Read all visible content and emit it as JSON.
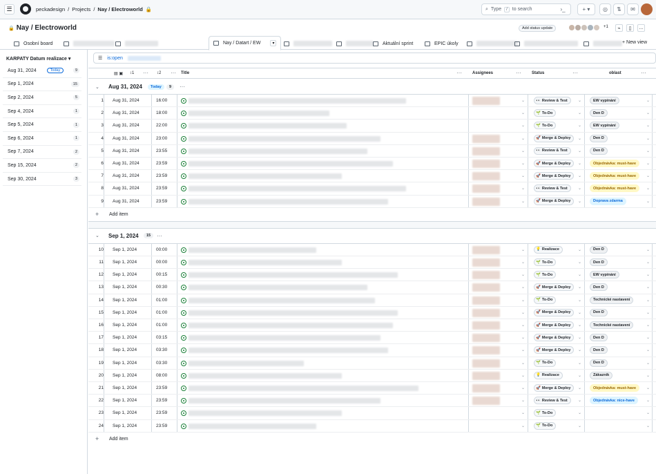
{
  "topbar": {
    "owner": "peckadesign",
    "projects": "Projects",
    "project": "Nay / Electroworld",
    "search_label": "Type",
    "search_key": "/",
    "search_suffix": "to search"
  },
  "title": {
    "name": "Nay / Electroworld",
    "status_update": "Add status update",
    "more_collaborators": "+1"
  },
  "tabs": [
    {
      "label": "Osobní board"
    },
    {
      "label": ""
    },
    {
      "label": ""
    },
    {
      "label": "Nay / Datart / EW"
    },
    {
      "label": ""
    },
    {
      "label": ""
    },
    {
      "label": "Aktuální sprint"
    },
    {
      "label": "EPIC úkoly"
    },
    {
      "label": ""
    },
    {
      "label": ""
    },
    {
      "label": ""
    }
  ],
  "new_view": "New view",
  "sidebar": {
    "header": "KARPATY Datum realizace",
    "items": [
      {
        "label": "Aug 31, 2024",
        "today": "Today",
        "count": "9"
      },
      {
        "label": "Sep 1, 2024",
        "count": "15"
      },
      {
        "label": "Sep 2, 2024",
        "count": "5"
      },
      {
        "label": "Sep 4, 2024",
        "count": "1"
      },
      {
        "label": "Sep 5, 2024",
        "count": "1"
      },
      {
        "label": "Sep 6, 2024",
        "count": "1"
      },
      {
        "label": "Sep 7, 2024",
        "count": "2"
      },
      {
        "label": "Sep 15, 2024",
        "count": "2"
      },
      {
        "label": "Sep 30, 2024",
        "count": "3"
      }
    ]
  },
  "filter": {
    "text": "is:open"
  },
  "columns": {
    "title": "Title",
    "assignees": "Assignees",
    "status": "Status",
    "area": "oblast",
    "sort1": "1",
    "sort2": "2"
  },
  "groups": [
    {
      "label": "Aug 31, 2024",
      "today": "Today",
      "count": "9"
    },
    {
      "label": "Sep 1, 2024",
      "count": "15"
    }
  ],
  "add_item": "Add item",
  "rows": [
    {
      "n": "1",
      "date": "Aug 31, 2024",
      "time": "16:00",
      "status": "Review & Test",
      "emoji": "👀",
      "area": "EW vypínání",
      "tw": 0.85,
      "assigned": true
    },
    {
      "n": "2",
      "date": "Aug 31, 2024",
      "time": "18:00",
      "status": "To-Do",
      "emoji": "🌱",
      "area": "Den D",
      "tw": 0.55,
      "assigned": false
    },
    {
      "n": "3",
      "date": "Aug 31, 2024",
      "time": "22:00",
      "status": "To-Do",
      "emoji": "🌱",
      "area": "EW vypínání",
      "tw": 0.62,
      "assigned": false
    },
    {
      "n": "4",
      "date": "Aug 31, 2024",
      "time": "23:00",
      "status": "Merge & Deploy",
      "emoji": "🚀",
      "area": "Den D",
      "tw": 0.75,
      "assigned": true
    },
    {
      "n": "5",
      "date": "Aug 31, 2024",
      "time": "23:55",
      "status": "Review & Test",
      "emoji": "👀",
      "area": "Den D",
      "tw": 0.7,
      "assigned": true
    },
    {
      "n": "6",
      "date": "Aug 31, 2024",
      "time": "23:59",
      "status": "Merge & Deploy",
      "emoji": "🚀",
      "area": "Objednávka: must-have",
      "tw": 0.8,
      "assigned": true
    },
    {
      "n": "7",
      "date": "Aug 31, 2024",
      "time": "23:59",
      "status": "Merge & Deploy",
      "emoji": "🚀",
      "area": "Objednávka: must-have",
      "tw": 0.6,
      "assigned": true
    },
    {
      "n": "8",
      "date": "Aug 31, 2024",
      "time": "23:59",
      "status": "Review & Test",
      "emoji": "👀",
      "area": "Objednávka: must-have",
      "tw": 0.85,
      "assigned": true
    },
    {
      "n": "9",
      "date": "Aug 31, 2024",
      "time": "23:59",
      "status": "Merge & Deploy",
      "emoji": "🚀",
      "area": "Doprava zdarma",
      "tw": 0.78,
      "assigned": true
    },
    {
      "n": "10",
      "date": "Sep 1, 2024",
      "time": "00:00",
      "status": "Realizace",
      "emoji": "💡",
      "area": "Den D",
      "tw": 0.5,
      "assigned": true
    },
    {
      "n": "11",
      "date": "Sep 1, 2024",
      "time": "00:00",
      "status": "To-Do",
      "emoji": "🌱",
      "area": "Den D",
      "tw": 0.6,
      "assigned": true
    },
    {
      "n": "12",
      "date": "Sep 1, 2024",
      "time": "00:15",
      "status": "To-Do",
      "emoji": "🌱",
      "area": "EW vypínání",
      "tw": 0.82,
      "assigned": true
    },
    {
      "n": "13",
      "date": "Sep 1, 2024",
      "time": "00:30",
      "status": "Merge & Deploy",
      "emoji": "🚀",
      "area": "Den D",
      "tw": 0.7,
      "assigned": true
    },
    {
      "n": "14",
      "date": "Sep 1, 2024",
      "time": "01:00",
      "status": "To-Do",
      "emoji": "🌱",
      "area": "Technické nastavení",
      "tw": 0.73,
      "assigned": true
    },
    {
      "n": "15",
      "date": "Sep 1, 2024",
      "time": "01:00",
      "status": "Merge & Deploy",
      "emoji": "🚀",
      "area": "Den D",
      "tw": 0.82,
      "assigned": true
    },
    {
      "n": "16",
      "date": "Sep 1, 2024",
      "time": "01:00",
      "status": "Merge & Deploy",
      "emoji": "🚀",
      "area": "Technické nastavení",
      "tw": 0.8,
      "assigned": true
    },
    {
      "n": "17",
      "date": "Sep 1, 2024",
      "time": "03:15",
      "status": "Merge & Deploy",
      "emoji": "🚀",
      "area": "Den D",
      "tw": 0.75,
      "assigned": true
    },
    {
      "n": "18",
      "date": "Sep 1, 2024",
      "time": "03:30",
      "status": "Merge & Deploy",
      "emoji": "🚀",
      "area": "Den D",
      "tw": 0.78,
      "assigned": true
    },
    {
      "n": "19",
      "date": "Sep 1, 2024",
      "time": "03:30",
      "status": "To-Do",
      "emoji": "🌱",
      "area": "Den D",
      "tw": 0.45,
      "assigned": true
    },
    {
      "n": "20",
      "date": "Sep 1, 2024",
      "time": "08:00",
      "status": "Realizace",
      "emoji": "💡",
      "area": "Zákazník",
      "tw": 0.6,
      "assigned": true
    },
    {
      "n": "21",
      "date": "Sep 1, 2024",
      "time": "23:59",
      "status": "Merge & Deploy",
      "emoji": "🚀",
      "area": "Objednávka: must-have",
      "tw": 0.9,
      "assigned": true
    },
    {
      "n": "22",
      "date": "Sep 1, 2024",
      "time": "23:59",
      "status": "Review & Test",
      "emoji": "👀",
      "area": "Objednávka: nice-have",
      "tw": 0.75,
      "assigned": true
    },
    {
      "n": "23",
      "date": "Sep 1, 2024",
      "time": "23:59",
      "status": "To-Do",
      "emoji": "🌱",
      "area": "",
      "tw": 0.6,
      "assigned": false
    },
    {
      "n": "24",
      "date": "Sep 1, 2024",
      "time": "23:59",
      "status": "To-Do",
      "emoji": "🌱",
      "area": "",
      "tw": 0.5,
      "assigned": false
    }
  ],
  "area_colors": {
    "Objednávka: must-have": "#fff8c5",
    "Objednávka: nice-have": "#ddf4ff",
    "Doprava zdarma": "#ddf4ff",
    "default": "#eff1f3"
  }
}
